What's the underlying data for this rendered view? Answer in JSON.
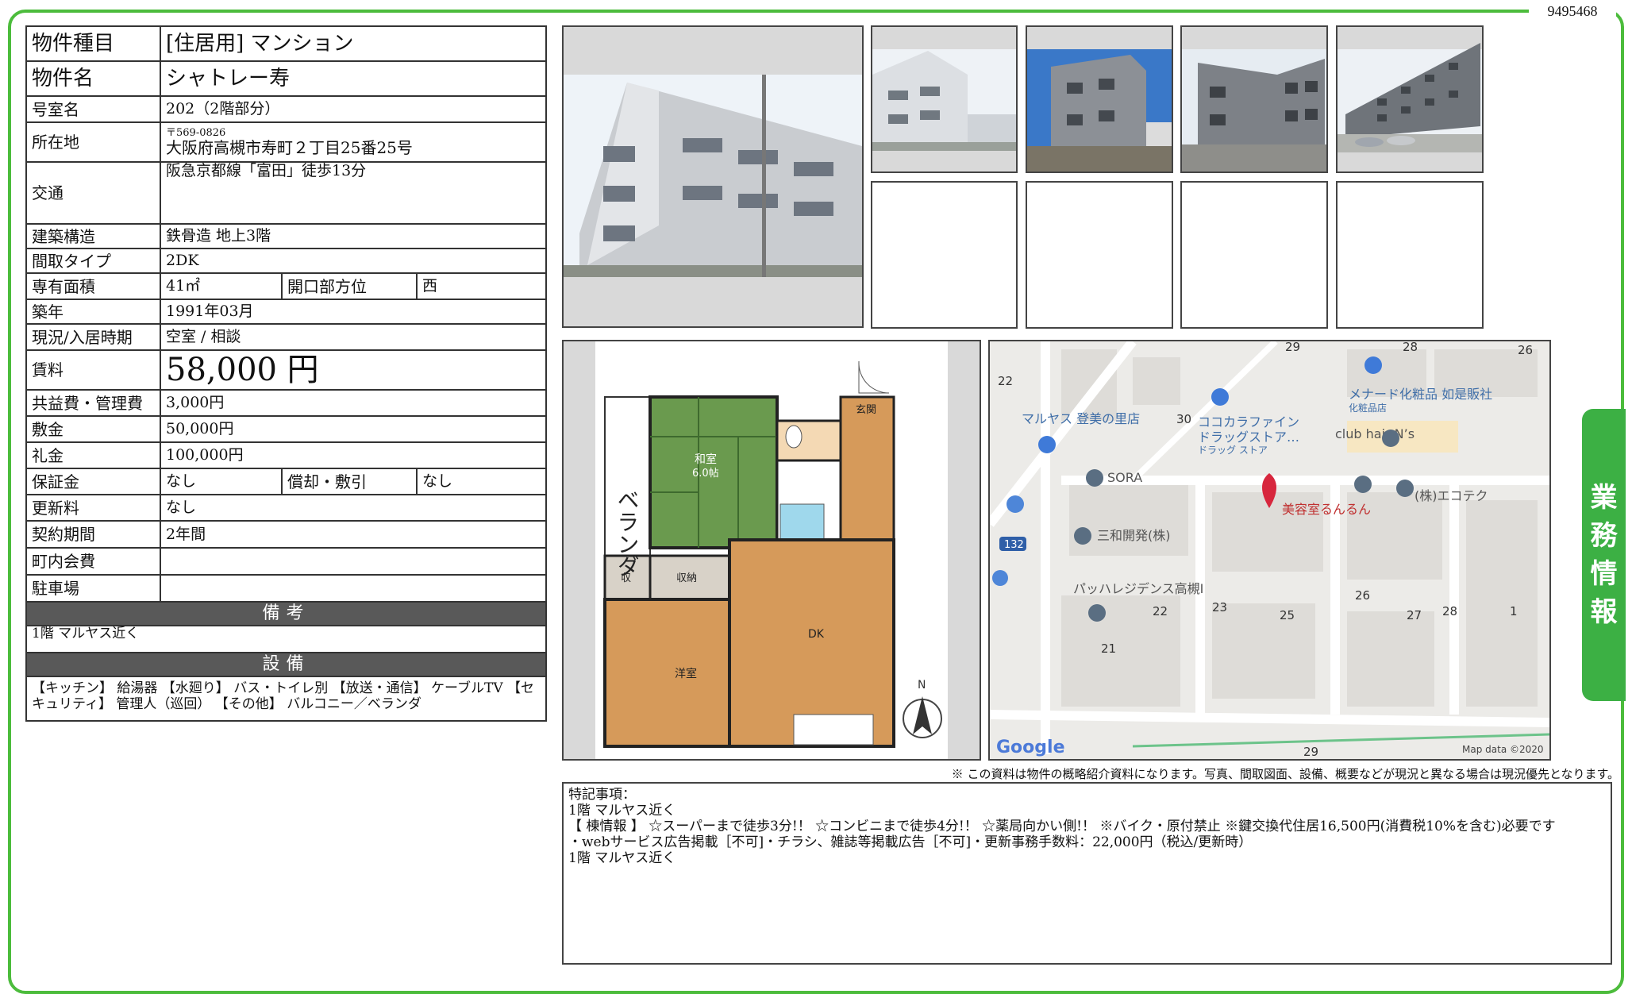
{
  "doc_number": "9495468",
  "side_tab": [
    "業",
    "務",
    "情",
    "報"
  ],
  "property": {
    "type_label": "物件種目",
    "type_value": "[住居用]  マンション",
    "name_label": "物件名",
    "name_value": "シャトレー寿",
    "room_label": "号室名",
    "room_value": "202（2階部分）",
    "address_label": "所在地",
    "zip": "〒569-0826",
    "address": "大阪府高槻市寿町２丁目25番25号",
    "transport_label": "交通",
    "transport_value": "阪急京都線「富田」徒歩13分",
    "structure_label": "建築構造",
    "structure_value": "鉄骨造  地上3階",
    "layout_label": "間取タイプ",
    "layout_value": "2DK",
    "area_label": "専有面積",
    "area_value": "41㎡",
    "direction_label": "開口部方位",
    "direction_value": "西",
    "built_label": "築年",
    "built_value": "1991年03月",
    "status_label": "現況/入居時期",
    "status_value": "空室  /  相談",
    "rent_label": "賃料",
    "rent_value": "58,000 円",
    "common_label": "共益費・管理費",
    "common_value": "3,000円",
    "deposit_label": "敷金",
    "deposit_value": "50,000円",
    "key_money_label": "礼金",
    "key_money_value": "100,000円",
    "guarantee_label": "保証金",
    "guarantee_value": "なし",
    "amortize_label": "償却・敷引",
    "amortize_value": "なし",
    "renewal_label": "更新料",
    "renewal_value": "なし",
    "contract_label": "契約期間",
    "contract_value": "2年間",
    "association_label": "町内会費",
    "association_value": "",
    "parking_label": "駐車場",
    "parking_value": ""
  },
  "remarks_header": "備考",
  "remarks_text": "1階  マルヤス近く",
  "equipment_header": "設備",
  "equipment_text": "【キッチン】 給湯器 【水廻り】 バス・トイレ別 【放送・通信】 ケーブルTV 【セキュリティ】 管理人（巡回） 【その他】 バルコニー／ベランダ",
  "floorplan": {
    "veranda": "ベランダ",
    "genkan": "玄関",
    "washitsu": "和室",
    "washitsu_size": "6.0帖",
    "shu": "収",
    "shuno": "収納",
    "yoshitsu": "洋室",
    "dk": "DK",
    "north": "N"
  },
  "map": {
    "labels": {
      "maruyasu": "マルヤス 登美の里店",
      "cocokara1": "ココカラファイン",
      "cocokara2": "ドラッグストア…",
      "cocokara3": "ドラッグ ストア",
      "menard1": "メナード化粧品 如是販社",
      "menard2": "化粧品店",
      "clubhair": "club hair N’s",
      "sora": "SORA",
      "ecotech": "(株)エコテク",
      "runrun": "美容室るんるん",
      "sanwa": "三和開発(株)",
      "pahha": "パッハレジデンス高槻Ⅰ",
      "google": "Google",
      "mapdata": "Map data ©2020",
      "route": "132"
    },
    "numbers": [
      "29",
      "28",
      "26",
      "22",
      "30",
      "22",
      "23",
      "25",
      "26",
      "27",
      "28",
      "1",
      "21",
      "29"
    ]
  },
  "notice": "※ この資料は物件の概略紹介資料になります。写真、間取図面、設備、概要などが現況と異なる場合は現況優先となります。",
  "special_notes": {
    "title": "特記事項：",
    "lines": [
      "1階  マルヤス近く",
      "【 棟情報 】 ☆スーパーまで徒歩3分!！ ☆コンビニまで徒歩4分!！ ☆薬局向かい側!！   ※バイク・原付禁止 ※鍵交換代住居16,500円(消費税10%を含む)必要です",
      "・webサービス広告掲載［不可]・チラシ、雑誌等掲載広告［不可]・更新事務手数料：22,000円（税込/更新時）",
      "1階  マルヤス近く"
    ]
  }
}
